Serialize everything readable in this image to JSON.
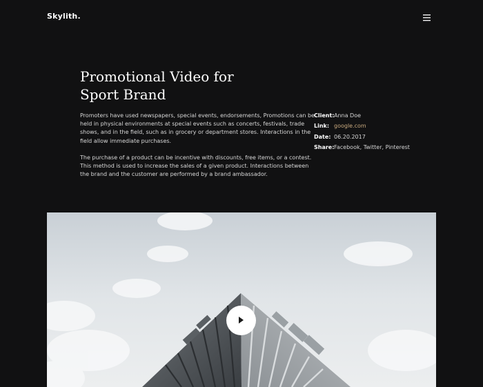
{
  "header": {
    "logo": "Skylith.",
    "menu_icon": "hamburger-menu-icon"
  },
  "project": {
    "title_line1": "Promotional Video for",
    "title_line2": "Sport Brand",
    "paragraph1": [
      "Promoters have used newspapers, special events, endorsements, Promotions can be",
      "held in physical environments at special events such as concerts, festivals, trade",
      "shows, and in the field, such as in grocery or department stores. Interactions in the",
      "field allow immediate purchases."
    ],
    "paragraph2": [
      "The purchase of a product can be incentive with discounts, free items, or a contest.",
      "This method is used to increase the sales of a given product. Interactions between",
      "the brand and the customer are performed by a brand ambassador."
    ]
  },
  "meta": {
    "client_label": "Client:",
    "client_value": "Anna Doe",
    "link_label": "Link:",
    "link_value": "google.com",
    "date_label": "Date:",
    "date_value": "06.20.2017",
    "share_label": "Share:",
    "share_facebook": "Facebook",
    "share_sep1": ", ",
    "share_twitter": "Twitter",
    "share_sep2": ", ",
    "share_pinterest": "Pinterest"
  },
  "video": {
    "play_icon": "play-icon"
  },
  "colors": {
    "background": "#111112",
    "accent_link": "#c8a97e",
    "heading": "#ffffff"
  }
}
